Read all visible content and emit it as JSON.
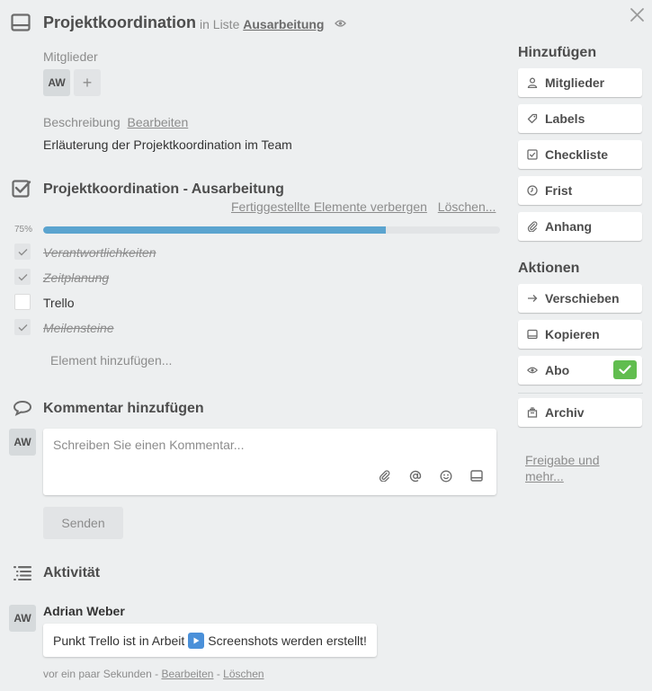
{
  "card": {
    "title": "Projektkoordination",
    "in_list_prefix": "in Liste",
    "list_name": "Ausarbeitung"
  },
  "members": {
    "label": "Mitglieder",
    "items": [
      {
        "initials": "AW"
      }
    ],
    "add_label": "+"
  },
  "description": {
    "label": "Beschreibung",
    "edit_label": "Bearbeiten",
    "text": "Erläuterung der Projektkoordination im Team"
  },
  "checklist": {
    "title": "Projektkoordination - Ausarbeitung",
    "hide_completed_label": "Fertiggestellte Elemente verbergen",
    "delete_label": "Löschen...",
    "progress_percent": 75,
    "progress_label": "75%",
    "items": [
      {
        "text": "Verantwortlichkeiten",
        "done": true
      },
      {
        "text": "Zeitplanung",
        "done": true
      },
      {
        "text": "Trello",
        "done": false
      },
      {
        "text": "Meilensteine",
        "done": true
      }
    ],
    "add_item_label": "Element hinzufügen..."
  },
  "comment": {
    "heading": "Kommentar hinzufügen",
    "avatar_initials": "AW",
    "placeholder": "Schreiben Sie einen Kommentar...",
    "value": "",
    "tools": [
      "paperclip-icon",
      "mention-icon",
      "emoji-icon",
      "card-icon"
    ],
    "send_label": "Senden"
  },
  "activity": {
    "heading": "Aktivität",
    "entries": [
      {
        "avatar_initials": "AW",
        "author": "Adrian Weber",
        "text_before": "Punkt Trello ist in Arbeit",
        "emoji": "play-button-emoji",
        "text_after": "Screenshots werden erstellt!",
        "time": "vor ein paar Sekunden",
        "separator": "-",
        "edit_label": "Bearbeiten",
        "delete_label": "Löschen"
      }
    ]
  },
  "sidebar": {
    "add_heading": "Hinzufügen",
    "add_buttons": [
      {
        "label": "Mitglieder",
        "icon": "person-icon"
      },
      {
        "label": "Labels",
        "icon": "label-icon"
      },
      {
        "label": "Checkliste",
        "icon": "checklist-icon"
      },
      {
        "label": "Frist",
        "icon": "clock-icon"
      },
      {
        "label": "Anhang",
        "icon": "paperclip-icon"
      }
    ],
    "actions_heading": "Aktionen",
    "action_buttons": [
      {
        "label": "Verschieben",
        "icon": "arrow-right-icon"
      },
      {
        "label": "Kopieren",
        "icon": "card-icon"
      },
      {
        "label": "Abo",
        "icon": "eye-icon",
        "subscribed": true
      },
      {
        "label": "Archiv",
        "icon": "archive-icon"
      }
    ],
    "share_label": "Freigabe und mehr..."
  },
  "colors": {
    "background": "#edeff0",
    "progress": "#5ba4cf",
    "subscribed_badge": "#61bd4f"
  }
}
